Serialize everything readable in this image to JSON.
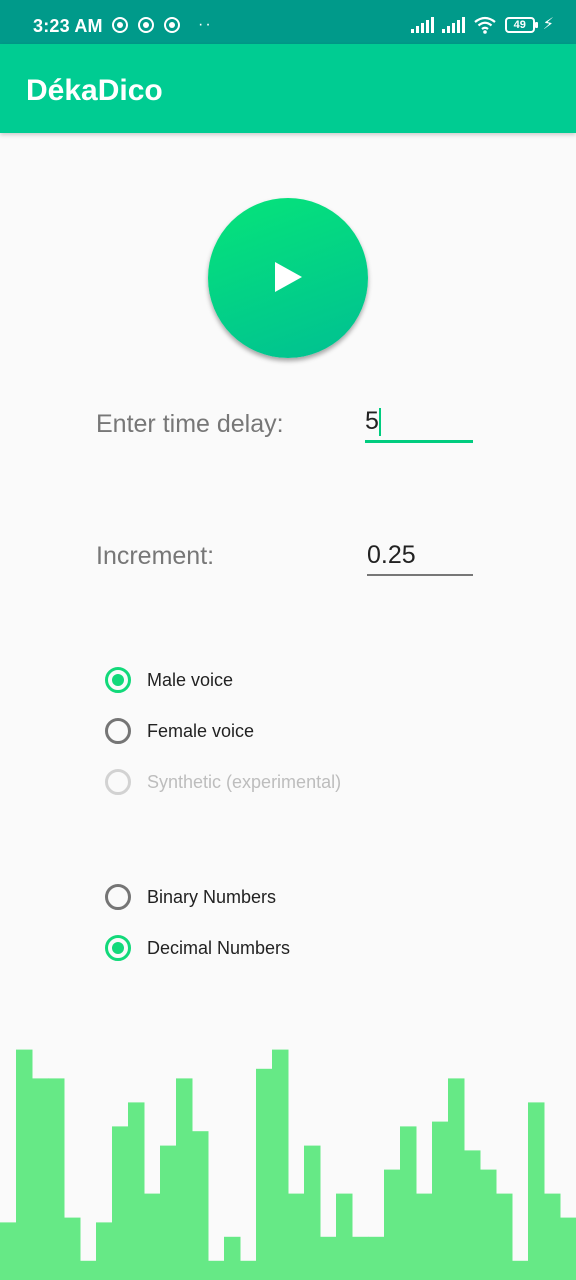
{
  "status_bar": {
    "time": "3:23 AM",
    "battery": "49",
    "dots": "··"
  },
  "app_bar": {
    "title": "DékaDico"
  },
  "player": {
    "play_icon": "play-icon"
  },
  "form": {
    "delay_label": "Enter time delay:",
    "delay_value": "5",
    "increment_label": "Increment:",
    "increment_value": "0.25"
  },
  "voice_options": [
    {
      "label": "Male voice",
      "checked": true,
      "enabled": true
    },
    {
      "label": "Female voice",
      "checked": false,
      "enabled": true
    },
    {
      "label": "Synthetic (experimental)",
      "checked": false,
      "enabled": false
    }
  ],
  "number_options": [
    {
      "label": "Binary Numbers",
      "checked": false
    },
    {
      "label": "Decimal Numbers",
      "checked": true
    }
  ],
  "colors": {
    "status_bar": "#009a8a",
    "app_bar": "#00cc92",
    "accent": "#12d97a",
    "bars": "#66e986"
  },
  "visualizer_levels": [
    0.24,
    0.96,
    0.84,
    0.84,
    0.26,
    0.08,
    0.24,
    0.64,
    0.74,
    0.36,
    0.56,
    0.84,
    0.62,
    0.08,
    0.18,
    0.08,
    0.88,
    0.96,
    0.36,
    0.56,
    0.18,
    0.36,
    0.18,
    0.18,
    0.46,
    0.64,
    0.36,
    0.66,
    0.84,
    0.54,
    0.46,
    0.36,
    0.08,
    0.74,
    0.36,
    0.26
  ]
}
